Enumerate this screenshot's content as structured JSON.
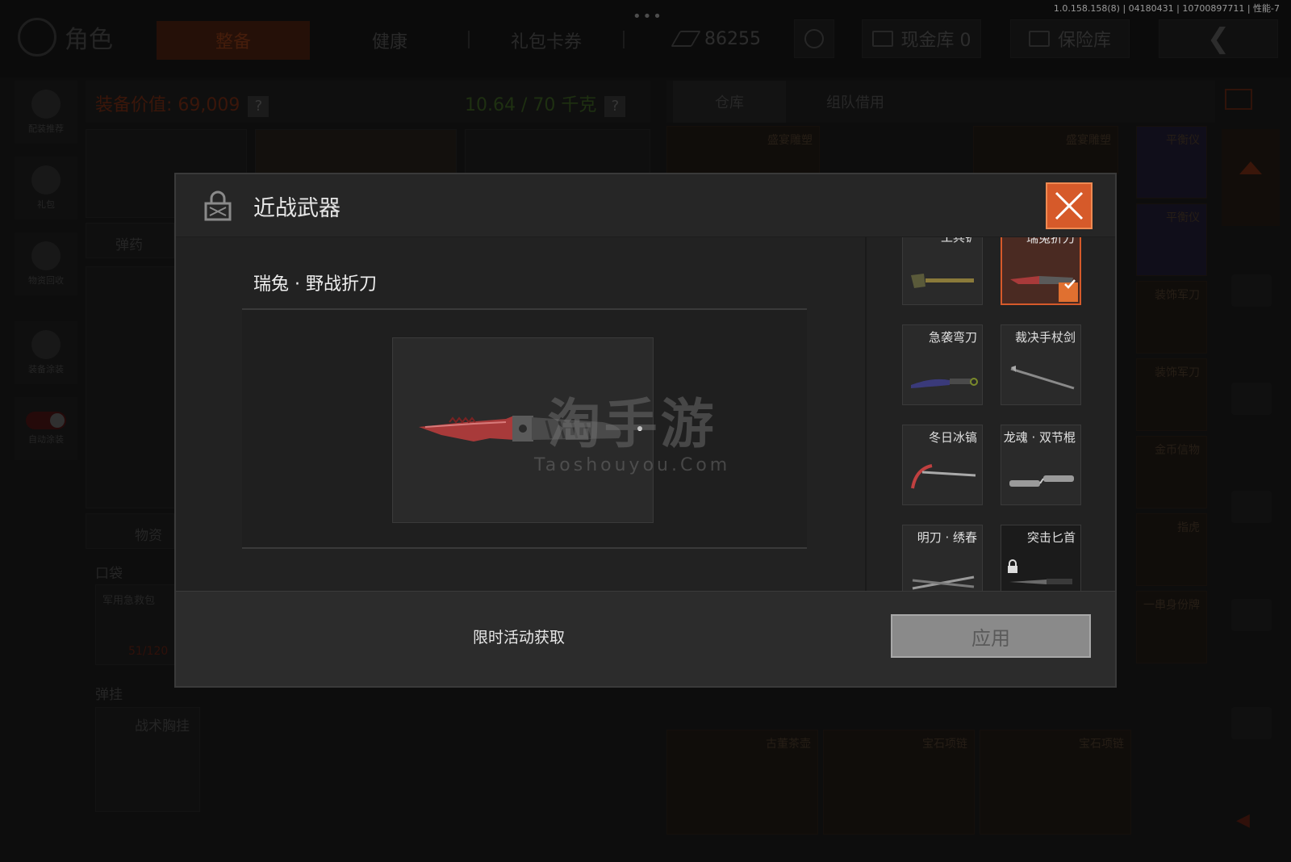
{
  "version_text": "1.0.158.158(8) | 04180431 | 10700897711 | 性能-7",
  "header": {
    "title": "角色",
    "tabs": [
      {
        "label": "整备"
      },
      {
        "label": "健康"
      },
      {
        "label": "礼包卡券"
      }
    ],
    "currency_value": "86255",
    "cash_vault_label": "现金库 0",
    "safe_label": "保险库"
  },
  "left_rail": {
    "items": [
      {
        "label": "配装推荐"
      },
      {
        "label": "礼包"
      },
      {
        "label": "物资回收"
      },
      {
        "label": "装备涂装"
      },
      {
        "label": "自动涂装"
      }
    ]
  },
  "equipment": {
    "value_label": "装备价值: 69,009",
    "weight_label": "10.64 / 70 千克",
    "ammo_label": "弹药",
    "supplies_label": "物资",
    "pocket_label": "口袋",
    "pocket_item": "军用急救包",
    "pocket_count": "51/120",
    "pendant_label": "弹挂",
    "pendant_item": "战术胸挂"
  },
  "storage": {
    "tabs": [
      {
        "label": "仓库"
      },
      {
        "label": "组队借用"
      }
    ],
    "items": [
      {
        "name": "盛宴雕塑"
      },
      {
        "name": "盛宴雕塑"
      },
      {
        "name": "平衡仪"
      },
      {
        "name": "平衡仪"
      },
      {
        "name": "装饰军刀"
      },
      {
        "name": "装饰军刀"
      },
      {
        "name": "金币信物"
      },
      {
        "name": "指虎"
      },
      {
        "name": "一串身份牌"
      },
      {
        "name": "古董茶壶"
      },
      {
        "name": "宝石项链"
      },
      {
        "name": "宝石项链"
      }
    ]
  },
  "modal": {
    "title": "近战武器",
    "item_name": "瑞兔 · 野战折刀",
    "acquire_text": "限时活动获取",
    "apply_label": "应用",
    "watermark_cn": "淘手游",
    "watermark_en": "Taoshouyou.Com",
    "weapons": [
      {
        "name": "工兵铲",
        "selected": false,
        "locked": false
      },
      {
        "name": "瑞兔折刀",
        "selected": true,
        "locked": false
      },
      {
        "name": "急袭弯刀",
        "selected": false,
        "locked": false
      },
      {
        "name": "裁决手杖剑",
        "selected": false,
        "locked": false
      },
      {
        "name": "冬日冰镐",
        "selected": false,
        "locked": false
      },
      {
        "name": "龙魂 · 双节棍",
        "selected": false,
        "locked": false
      },
      {
        "name": "明刀 · 绣春",
        "selected": false,
        "locked": false
      },
      {
        "name": "突击匕首",
        "selected": false,
        "locked": true
      }
    ]
  },
  "colors": {
    "accent": "#d65a2a",
    "apply_disabled": "#8a8a8a"
  }
}
